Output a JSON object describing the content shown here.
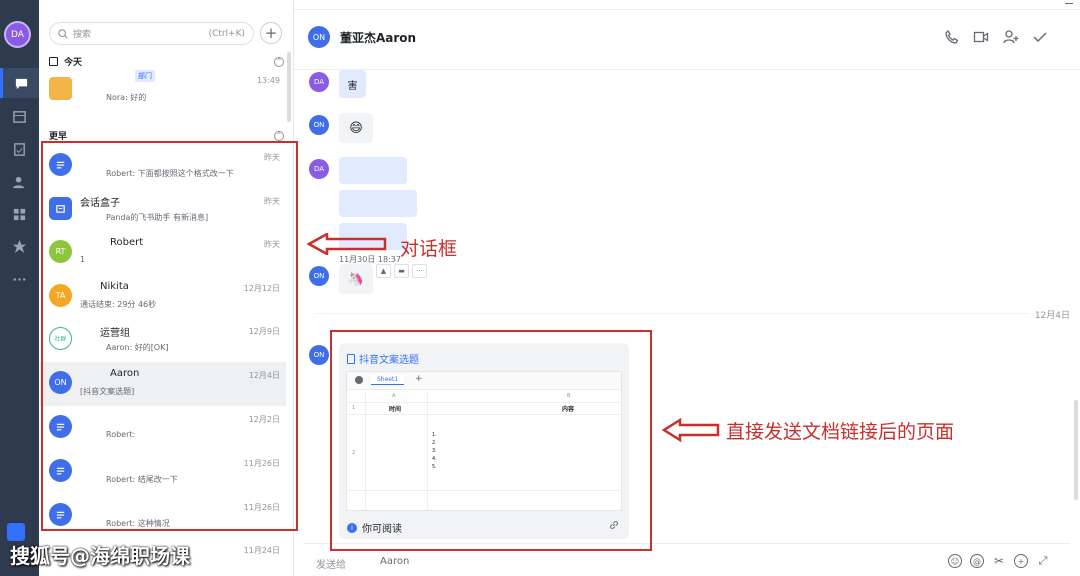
{
  "user": {
    "initials": "DA"
  },
  "search": {
    "placeholder": "搜索",
    "shortcut": "(Ctrl+K)"
  },
  "sections": {
    "today": "今天",
    "earlier": "更早"
  },
  "chats": [
    {
      "name": "",
      "tag": "部门",
      "time": "13:49",
      "sub": "Nora: 好的",
      "avatar": "",
      "color": "#f3b44a",
      "group": "today"
    },
    {
      "name": "",
      "time": "昨天",
      "sub": "Robert: 下面都按照这个格式改一下",
      "avatar": "doc",
      "color": "#3f6ee8"
    },
    {
      "name": "会话盒子",
      "time": "昨天",
      "sub": "Panda的飞书助手 有新消息]",
      "avatar": "box",
      "color": "#3f6ee8"
    },
    {
      "name": "Robert",
      "time": "昨天",
      "sub": "1",
      "avatar": "RT",
      "color": "#8cc63f"
    },
    {
      "name": "Nikita",
      "time": "12月12日",
      "sub": "通话结束: 29分 46秒",
      "avatar": "TA",
      "color": "#f5a623"
    },
    {
      "name": "运营组",
      "time": "12月9日",
      "sub": "Aaron: 好的[OK]",
      "avatar": "社群",
      "color": "#ffffff"
    },
    {
      "name": "Aaron",
      "time": "12月4日",
      "sub": "[抖音文案选题]",
      "avatar": "ON",
      "color": "#3f6ee8",
      "selected": true
    },
    {
      "name": "",
      "time": "12月2日",
      "sub": "Robert:",
      "avatar": "doc",
      "color": "#3f6ee8"
    },
    {
      "name": "",
      "time": "11月26日",
      "sub": "Robert: 结尾改一下",
      "avatar": "doc",
      "color": "#3f6ee8"
    },
    {
      "name": "",
      "time": "11月26日",
      "sub": "Robert: 这种情况",
      "avatar": "doc",
      "color": "#3f6ee8"
    },
    {
      "name": "",
      "time": "11月24日",
      "sub": "",
      "avatar": "",
      "color": "#3f6ee8"
    }
  ],
  "conversation": {
    "title": "董亚杰Aaron",
    "avatar": "ON",
    "messages": [
      {
        "from": "DA",
        "text": "害"
      },
      {
        "from": "ON",
        "text": "😄"
      },
      {
        "from": "DA",
        "text": ""
      },
      {
        "from": "ON",
        "text": "🦄"
      }
    ],
    "timestamp": "11月30日 18:37",
    "date_divider": "12月4日",
    "doc_card": {
      "title": "抖音文案选题",
      "sheet_tab": "Sheet1",
      "col_a": "A",
      "col_b": "B",
      "header_time": "时间",
      "header_content": "内容",
      "row1": "1",
      "row2": "2",
      "list": [
        "1.",
        "2.",
        "3.",
        "4.",
        "5."
      ],
      "permission": "你可阅读"
    },
    "composer": {
      "label": "发送给",
      "recipient": "Aaron"
    }
  },
  "annotations": {
    "dialog_box": "对话框",
    "doc_link_page": "直接发送文档链接后的页面"
  },
  "watermark": "搜狐号@海绵职场课",
  "colors": {
    "accent": "#3370ff",
    "annotation": "#c9302c",
    "rail": "#2e3a4d"
  }
}
